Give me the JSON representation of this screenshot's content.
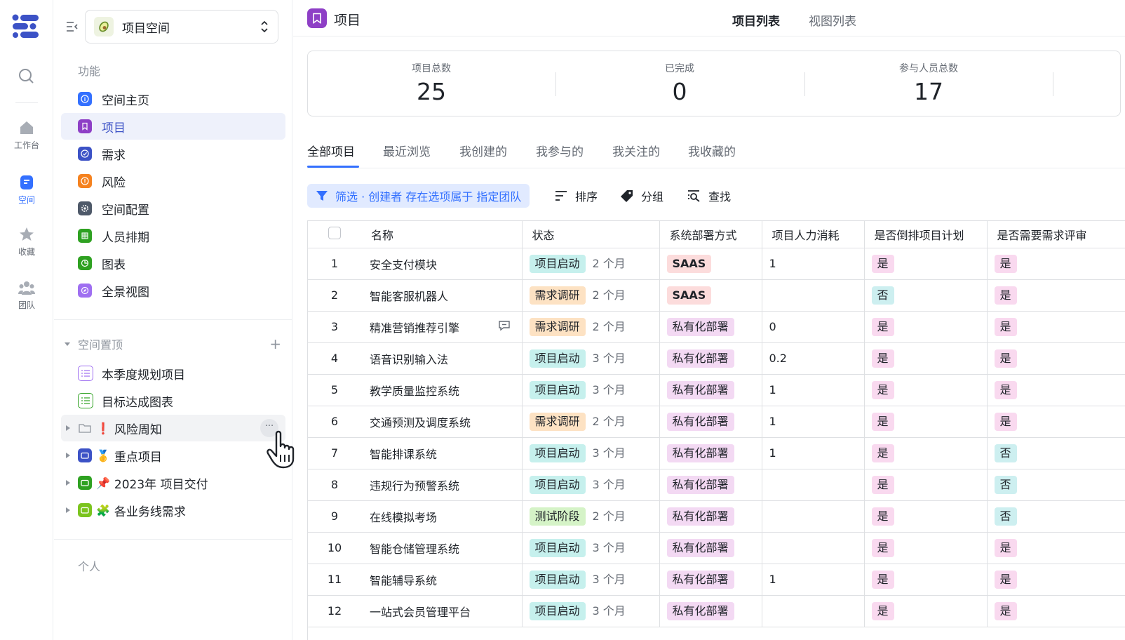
{
  "rail": {
    "items": [
      {
        "label": "工作台",
        "icon": "home-icon"
      },
      {
        "label": "空间",
        "icon": "space-icon",
        "active": true
      },
      {
        "label": "收藏",
        "icon": "star-icon"
      },
      {
        "label": "团队",
        "icon": "team-icon"
      }
    ]
  },
  "sidebar": {
    "space_name": "项目空间",
    "section_function": "功能",
    "nav": [
      {
        "label": "空间主页",
        "color": "#3370ff"
      },
      {
        "label": "项目",
        "color": "#8e3fc6",
        "active": true
      },
      {
        "label": "需求",
        "color": "#3c52c6"
      },
      {
        "label": "风险",
        "color": "#f5821f"
      },
      {
        "label": "空间配置",
        "color": "#4e5969"
      },
      {
        "label": "人员排期",
        "color": "#2ea121"
      },
      {
        "label": "图表",
        "color": "#2ea121"
      },
      {
        "label": "全景视图",
        "color": "#9f6ff1"
      }
    ],
    "section_pinned": "空间置顶",
    "pinned_lists": [
      {
        "label": "本季度规划项目",
        "color": "#9f6ff1"
      },
      {
        "label": "目标达成图表",
        "color": "#2ea121"
      }
    ],
    "pinned_folders": [
      {
        "emoji": "❗",
        "label": "风险周知",
        "color": "#8f959e"
      },
      {
        "emoji": "🥇",
        "label": "重点项目",
        "color": "#3c52c6"
      },
      {
        "emoji": "📌",
        "label": "2023年 项目交付",
        "color": "#2ea121"
      },
      {
        "emoji": "🧩",
        "label": "各业务线需求",
        "color": "#7bc41e"
      }
    ],
    "more_label": "···",
    "section_personal": "个人"
  },
  "header": {
    "title": "项目",
    "tabs": [
      "项目列表",
      "视图列表"
    ]
  },
  "stats": [
    {
      "label": "项目总数",
      "value": "25"
    },
    {
      "label": "已完成",
      "value": "0"
    },
    {
      "label": "参与人员总数",
      "value": "17"
    }
  ],
  "tabs": [
    "全部项目",
    "最近浏览",
    "我创建的",
    "我参与的",
    "我关注的",
    "我收藏的"
  ],
  "toolbar": {
    "filter": "筛选 · 创建者 存在选项属于 指定团队",
    "sort": "排序",
    "group": "分组",
    "find": "查找"
  },
  "table": {
    "columns": [
      "名称",
      "状态",
      "系统部署方式",
      "项目人力消耗",
      "是否倒排项目计划",
      "是否需要需求评审"
    ],
    "rows": [
      {
        "no": "1",
        "name": "安全支付模块",
        "status": "项目启动",
        "duration": "2 个月",
        "deploy": "SAAS",
        "effort": "1",
        "reverse": "是",
        "review": "是"
      },
      {
        "no": "2",
        "name": "智能客服机器人",
        "status": "需求调研",
        "duration": "2 个月",
        "deploy": "SAAS",
        "effort": "",
        "reverse": "否",
        "review": "是"
      },
      {
        "no": "3",
        "name": "精准营销推荐引擎",
        "status": "需求调研",
        "duration": "2 个月",
        "deploy": "私有化部署",
        "effort": "0",
        "reverse": "是",
        "review": "是",
        "comment": true
      },
      {
        "no": "4",
        "name": "语音识别输入法",
        "status": "项目启动",
        "duration": "3 个月",
        "deploy": "私有化部署",
        "effort": "0.2",
        "reverse": "是",
        "review": "是"
      },
      {
        "no": "5",
        "name": "教学质量监控系统",
        "status": "项目启动",
        "duration": "3 个月",
        "deploy": "私有化部署",
        "effort": "1",
        "reverse": "是",
        "review": "是"
      },
      {
        "no": "6",
        "name": "交通预测及调度系统",
        "status": "需求调研",
        "duration": "2 个月",
        "deploy": "私有化部署",
        "effort": "1",
        "reverse": "是",
        "review": "是"
      },
      {
        "no": "7",
        "name": "智能排课系统",
        "status": "项目启动",
        "duration": "3 个月",
        "deploy": "私有化部署",
        "effort": "1",
        "reverse": "是",
        "review": "否"
      },
      {
        "no": "8",
        "name": "违规行为预警系统",
        "status": "项目启动",
        "duration": "3 个月",
        "deploy": "私有化部署",
        "effort": "",
        "reverse": "是",
        "review": "否"
      },
      {
        "no": "9",
        "name": "在线模拟考场",
        "status": "测试阶段",
        "duration": "2 个月",
        "deploy": "私有化部署",
        "effort": "",
        "reverse": "是",
        "review": "否"
      },
      {
        "no": "10",
        "name": "智能仓储管理系统",
        "status": "项目启动",
        "duration": "3 个月",
        "deploy": "私有化部署",
        "effort": "",
        "reverse": "是",
        "review": "是"
      },
      {
        "no": "11",
        "name": "智能辅导系统",
        "status": "项目启动",
        "duration": "3 个月",
        "deploy": "私有化部署",
        "effort": "1",
        "reverse": "是",
        "review": "是"
      },
      {
        "no": "12",
        "name": "一站式会员管理平台",
        "status": "项目启动",
        "duration": "3 个月",
        "deploy": "私有化部署",
        "effort": "",
        "reverse": "是",
        "review": "是"
      }
    ]
  },
  "colors": {
    "accent": "#3370ff",
    "status_start_bg": "#c6f0ed",
    "status_research_bg": "#fde2c3",
    "status_test_bg": "#d5f3c7",
    "deploy_saas_bg": "#fcdcdc",
    "deploy_private_bg": "#f3d9f3",
    "yes_bg": "#f9d9ef",
    "no_bg": "#cdeff0"
  }
}
